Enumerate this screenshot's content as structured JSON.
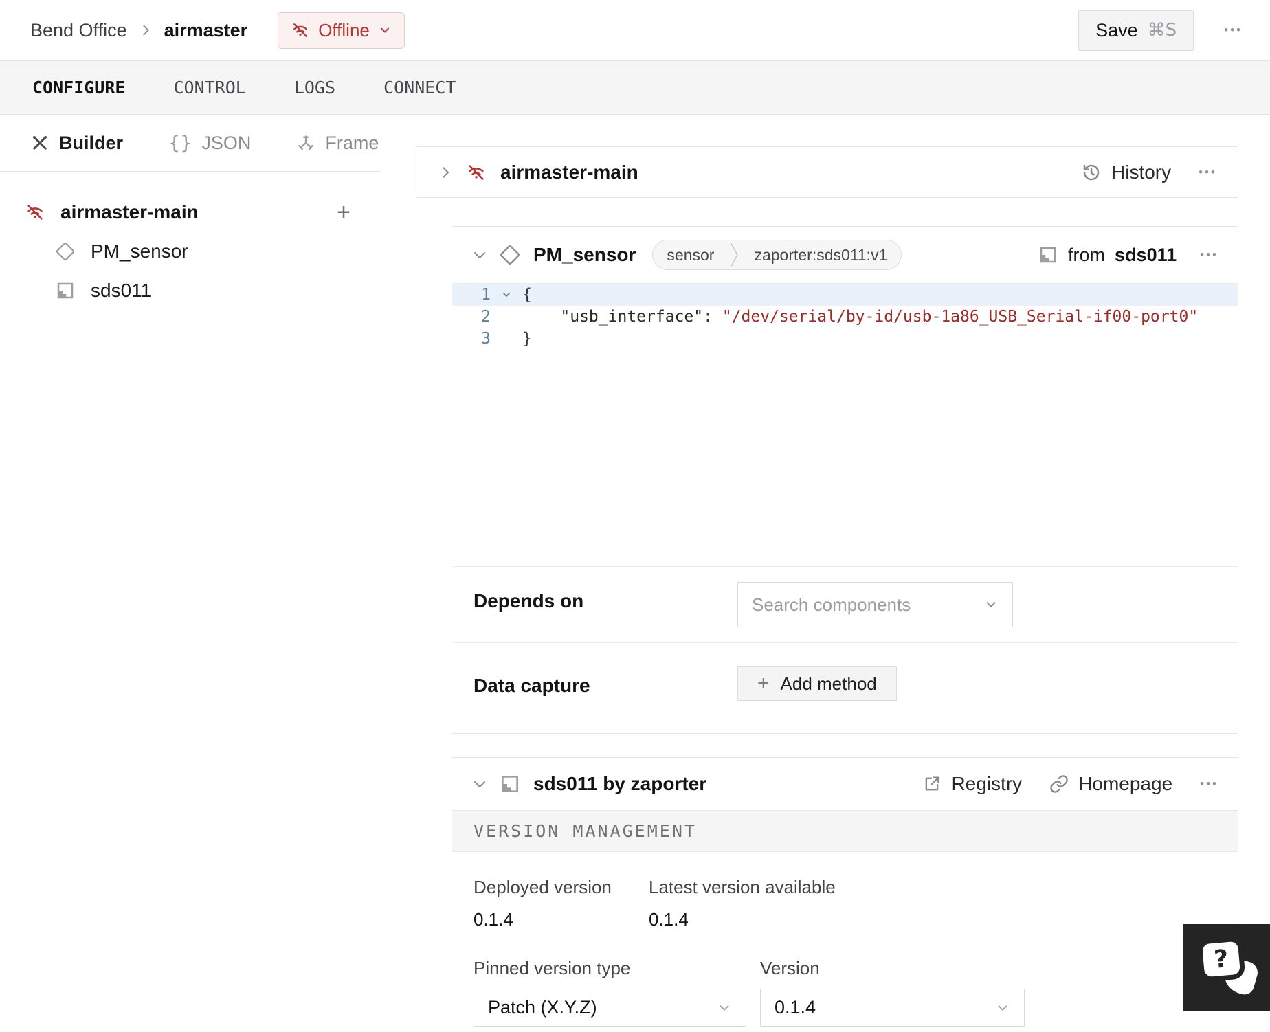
{
  "ui": {
    "menu_glyph": "•••",
    "plus_glyph": "+",
    "json_glyph": "{}",
    "help_glyph": "?"
  },
  "header": {
    "breadcrumb_location": "Bend Office",
    "machine_name": "airmaster",
    "status": {
      "label": "Offline"
    },
    "save": {
      "label": "Save",
      "shortcut": "⌘S"
    }
  },
  "tabs": [
    {
      "label": "CONFIGURE"
    },
    {
      "label": "CONTROL"
    },
    {
      "label": "LOGS"
    },
    {
      "label": "CONNECT"
    }
  ],
  "sidebar": {
    "modes": [
      {
        "label": "Builder"
      },
      {
        "label": "JSON"
      },
      {
        "label": "Frame"
      }
    ],
    "tree": {
      "root": "airmaster-main",
      "children": [
        {
          "label": "PM_sensor"
        },
        {
          "label": "sds011"
        }
      ]
    }
  },
  "main": {
    "part_card": {
      "title": "airmaster-main",
      "history_label": "History"
    },
    "component_card": {
      "title": "PM_sensor",
      "type_badge": "sensor",
      "model_badge": "zaporter:sds011:v1",
      "from_prefix": "from",
      "from_module": "sds011",
      "code": {
        "line1": {
          "num": "1",
          "text": "{"
        },
        "line2": {
          "num": "2",
          "key": "    \"usb_interface\"",
          "colon": ": ",
          "value": "\"/dev/serial/by-id/usb-1a86_USB_Serial-if00-port0\""
        },
        "line3": {
          "num": "3",
          "text": "}"
        }
      },
      "depends_on": {
        "label": "Depends on",
        "placeholder": "Search components"
      },
      "data_capture": {
        "label": "Data capture",
        "button_label": "Add method"
      }
    },
    "module_card": {
      "title": "sds011 by zaporter",
      "registry_label": "Registry",
      "homepage_label": "Homepage",
      "section_title": "VERSION MANAGEMENT",
      "deployed": {
        "label": "Deployed version",
        "value": "0.1.4"
      },
      "latest": {
        "label": "Latest version available",
        "value": "0.1.4"
      },
      "pinned_type": {
        "label": "Pinned version type",
        "value": "Patch (X.Y.Z)"
      },
      "version": {
        "label": "Version",
        "value": "0.1.4"
      }
    }
  },
  "colors": {
    "accent_red": "#b23a34",
    "code_string_red": "#9e2b25",
    "line_number_blue": "#5d7d99",
    "active_line_bg": "#e9f1fa",
    "badge_bg": "#fbf1f0",
    "help_bg": "#242425"
  }
}
